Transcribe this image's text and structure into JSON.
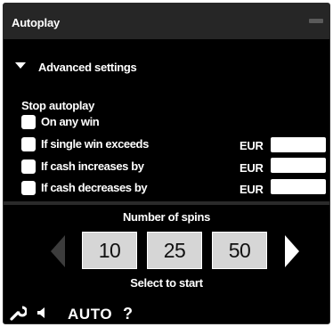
{
  "window": {
    "title": "Autoplay"
  },
  "advanced": {
    "label": "Advanced settings"
  },
  "stop": {
    "title": "Stop autoplay",
    "options": [
      {
        "label": "On any win",
        "checked": false
      },
      {
        "label": "If single win exceeds",
        "checked": false,
        "currency": "EUR",
        "value": ""
      },
      {
        "label": "If cash increases by",
        "checked": false,
        "currency": "EUR",
        "value": ""
      },
      {
        "label": "If cash decreases by",
        "checked": false,
        "currency": "EUR",
        "value": ""
      }
    ]
  },
  "spins": {
    "title": "Number of spins",
    "buttons": [
      "10",
      "25",
      "50"
    ],
    "hint": "Select to start"
  },
  "toolbar": {
    "icons": [
      "wrench-icon",
      "speaker-icon",
      "help-icon"
    ],
    "auto_label": "AUTO",
    "help_label": "?"
  },
  "colors": {
    "background": "#000000",
    "titlebar": "#262626",
    "button_fill": "#d6d6d6",
    "arrow_disabled": "#3c3c3c",
    "text": "#ffffff"
  }
}
